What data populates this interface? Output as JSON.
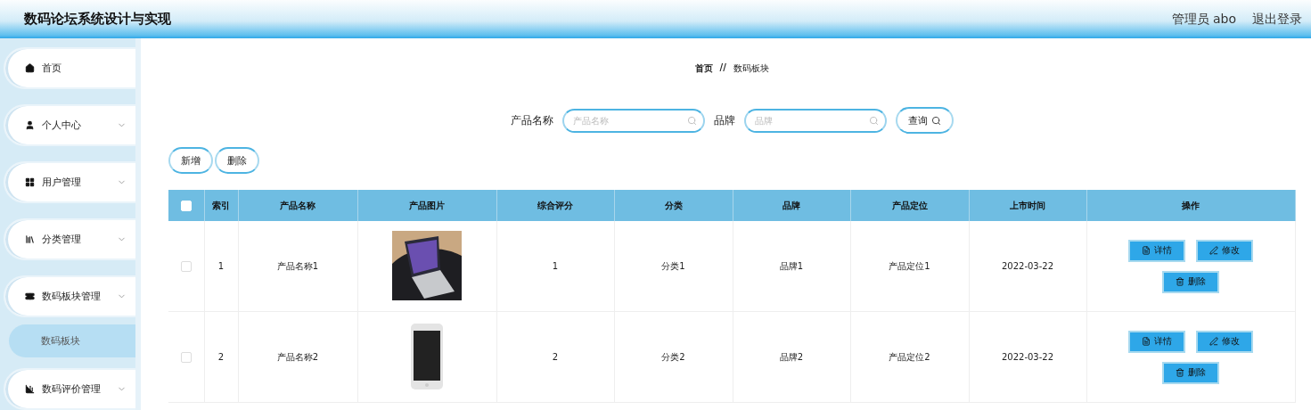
{
  "header": {
    "title": "数码论坛系统设计与实现",
    "user": "管理员 abo",
    "logout": "退出登录"
  },
  "sidebar": {
    "items": [
      {
        "label": "首页",
        "kind": "link"
      },
      {
        "label": "个人中心",
        "kind": "menu"
      },
      {
        "label": "用户管理",
        "kind": "menu"
      },
      {
        "label": "分类管理",
        "kind": "menu"
      },
      {
        "label": "数码板块管理",
        "kind": "menu",
        "children": [
          {
            "label": "数码板块",
            "selected": true
          }
        ]
      },
      {
        "label": "数码评价管理",
        "kind": "menu"
      }
    ]
  },
  "breadcrumb": {
    "home": "首页",
    "separator": "//",
    "current": "数码板块"
  },
  "search": {
    "fields": [
      {
        "label": "产品名称",
        "placeholder": "产品名称"
      },
      {
        "label": "品牌",
        "placeholder": "品牌"
      }
    ],
    "button": "查询"
  },
  "actions": [
    "新增",
    "删除"
  ],
  "table": {
    "all_checked": false,
    "columns": [
      "索引",
      "产品名称",
      "产品图片",
      "综合评分",
      "分类",
      "品牌",
      "产品定位",
      "上市时间",
      "操作"
    ],
    "rows": [
      {
        "checked": false,
        "index": "1",
        "name": "产品名称1",
        "picture": {
          "kind": "laptop"
        },
        "score": "1",
        "category": "分类1",
        "brand": "品牌1",
        "position": "产品定位1",
        "date": "2022-03-22",
        "buttons": [
          "详情",
          "修改",
          "删除"
        ]
      },
      {
        "checked": false,
        "index": "2",
        "name": "产品名称2",
        "picture": {
          "kind": "phone"
        },
        "score": "2",
        "category": "分类2",
        "brand": "品牌2",
        "position": "产品定位2",
        "date": "2022-03-22",
        "buttons": [
          "详情",
          "修改",
          "删除"
        ]
      }
    ]
  }
}
